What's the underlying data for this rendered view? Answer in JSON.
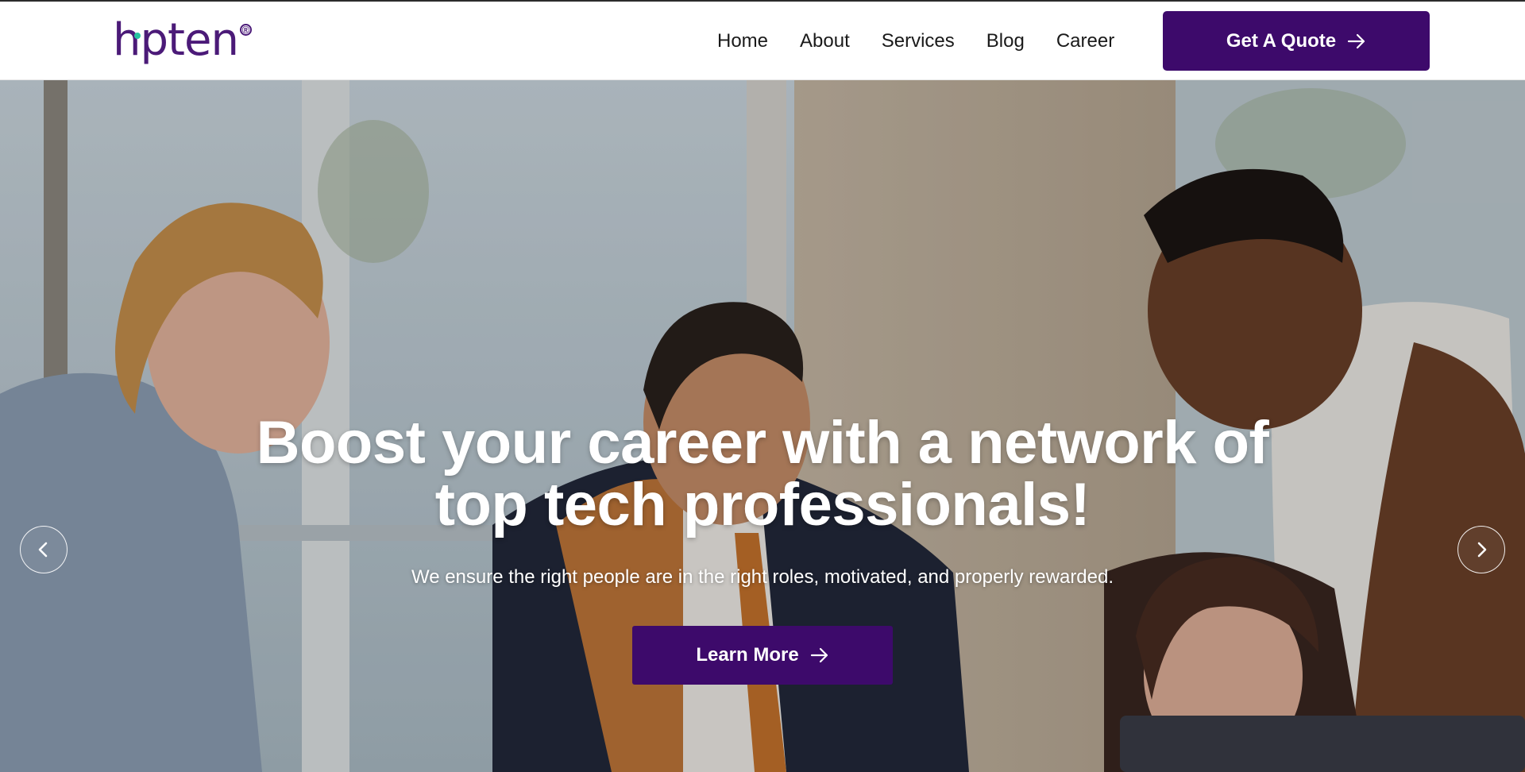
{
  "brand": {
    "logo_text": "hpten",
    "logo_mark": "®",
    "primary_color": "#3d0a6b",
    "accent_color": "#27c3a0"
  },
  "nav": {
    "links": [
      {
        "label": "Home"
      },
      {
        "label": "About"
      },
      {
        "label": "Services"
      },
      {
        "label": "Blog"
      },
      {
        "label": "Career"
      }
    ],
    "cta_label": "Get A Quote",
    "cta_icon": "arrow-right-icon"
  },
  "hero": {
    "title": "Boost your career with a network of top tech professionals!",
    "subtitle": "We ensure the right people are in the right roles, motivated, and properly rewarded.",
    "button_label": "Learn More",
    "button_icon": "arrow-right-icon",
    "prev_icon": "chevron-left-icon",
    "next_icon": "chevron-right-icon"
  }
}
